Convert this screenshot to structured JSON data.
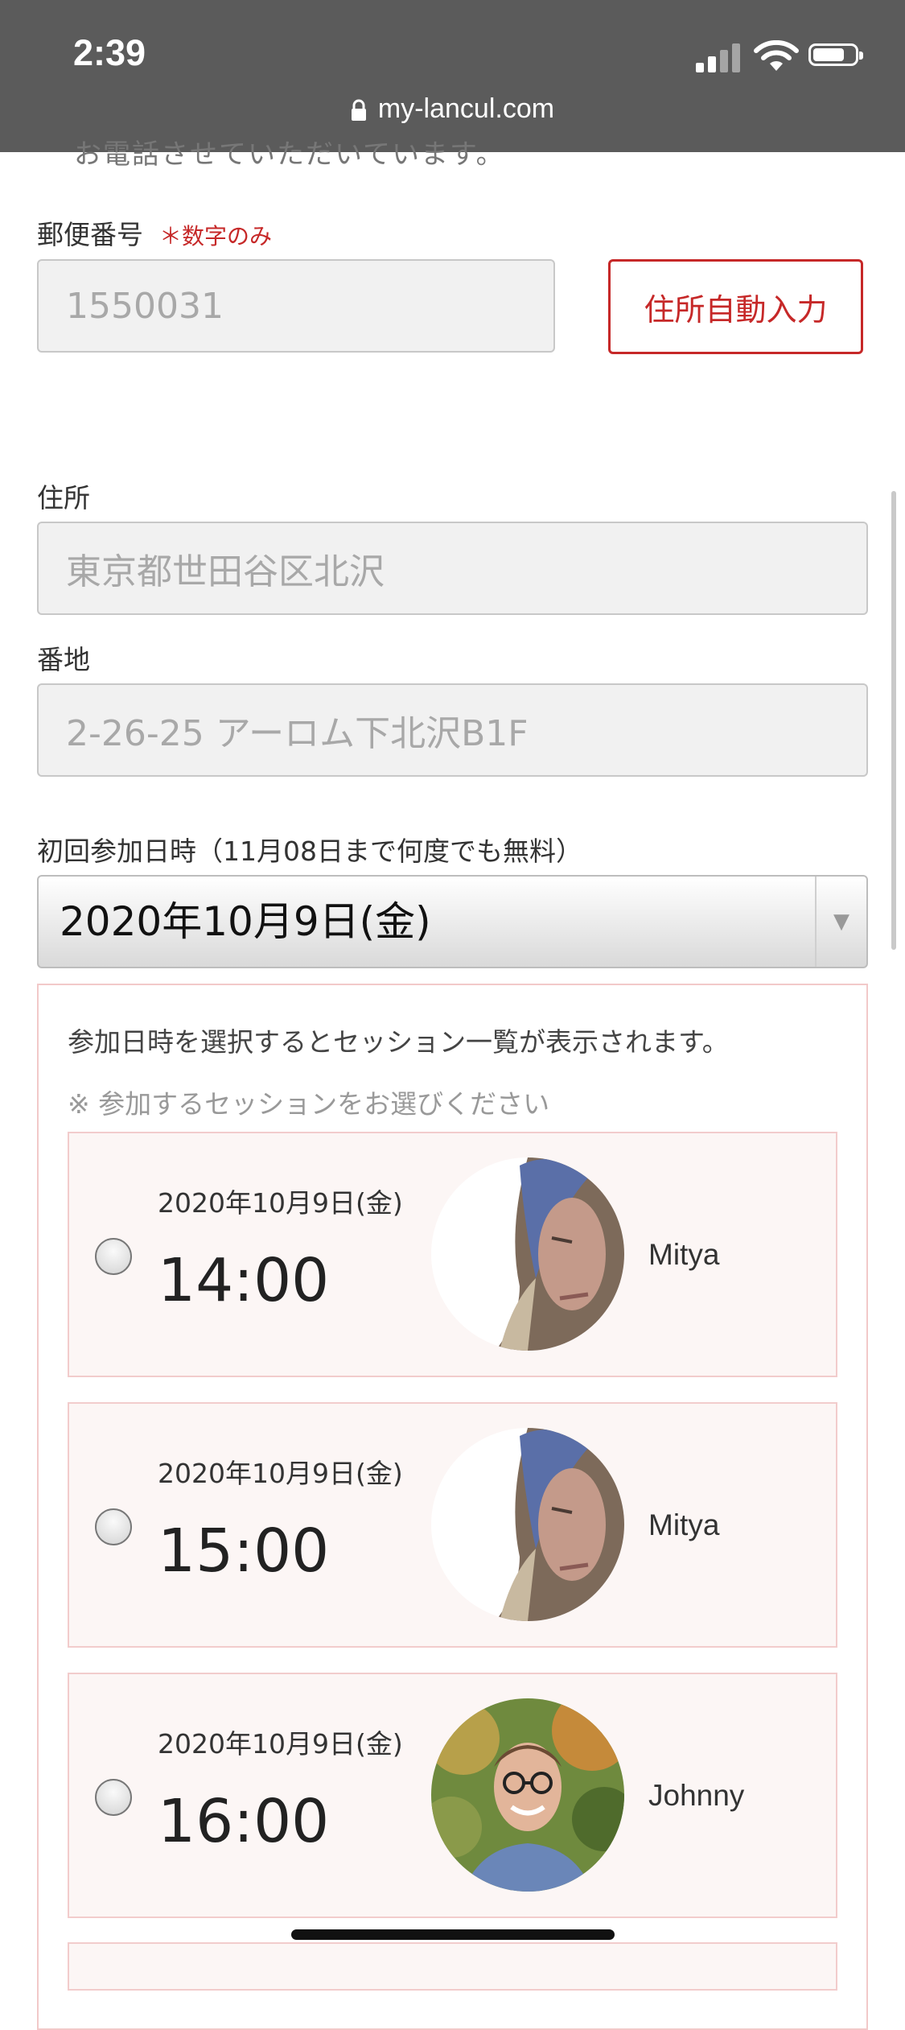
{
  "status_bar": {
    "time": "2:39"
  },
  "browser": {
    "url": "my-lancul.com"
  },
  "form": {
    "cut_text": "お電話させていただいています。",
    "postal": {
      "label": "郵便番号",
      "required_note": "＊数字のみ",
      "value": "1550031",
      "auto_fill_button": "住所自動入力"
    },
    "address": {
      "label": "住所",
      "value": "東京都世田谷区北沢"
    },
    "street": {
      "label": "番地",
      "value": "2-26-25 アーロム下北沢B1F"
    },
    "first_date": {
      "label": "初回参加日時（11月08日まで何度でも無料）",
      "selected": "2020年10月9日(金)"
    }
  },
  "sessions": {
    "info": "参加日時を選択するとセッション一覧が表示されます。",
    "note": "※ 参加するセッションをお選びください",
    "items": [
      {
        "date": "2020年10月9日(金)",
        "time": "14:00",
        "instructor": "Mitya"
      },
      {
        "date": "2020年10月9日(金)",
        "time": "15:00",
        "instructor": "Mitya"
      },
      {
        "date": "2020年10月9日(金)",
        "time": "16:00",
        "instructor": "Johnny"
      }
    ]
  },
  "colors": {
    "accent": "#c62828",
    "topbar": "#5b5b5b",
    "card_bg": "#fcf6f5"
  }
}
